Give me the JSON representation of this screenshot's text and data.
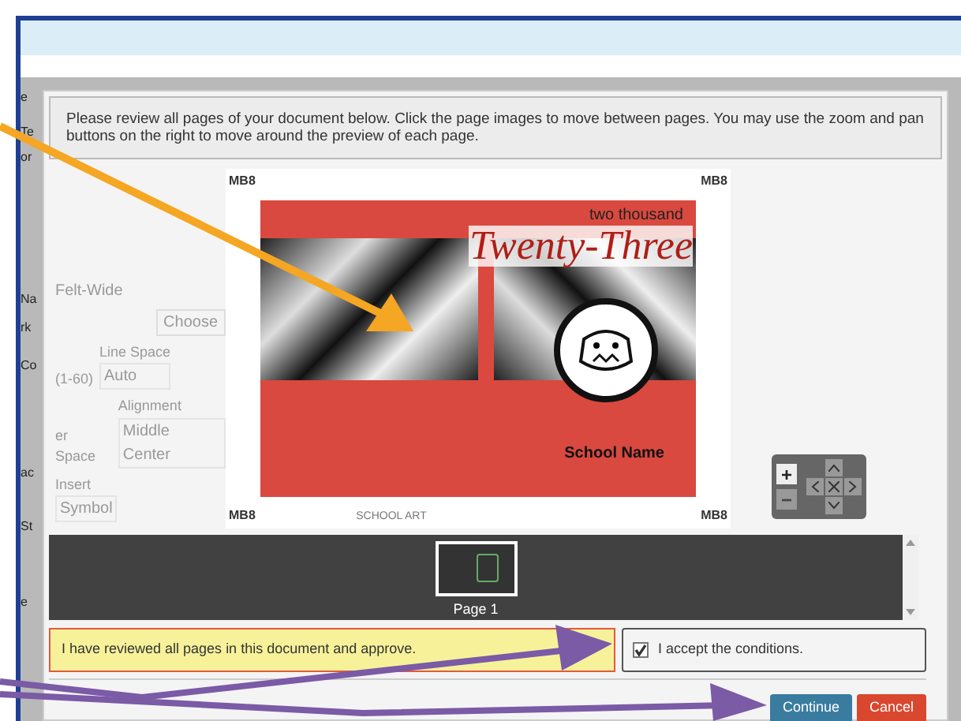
{
  "app_sidebar_fragments": [
    "e",
    "Te",
    "or",
    "Na",
    "rk",
    "Co",
    "ac",
    "St",
    "e"
  ],
  "background_form": [
    {
      "kind": "select",
      "value": "Felt-Wide"
    },
    {
      "kind": "button",
      "value": "Choose"
    },
    {
      "kind": "pair",
      "label": "Line Space",
      "value": "Auto",
      "side": "(1-60)"
    },
    {
      "kind": "pair",
      "label": "Alignment",
      "value": "Middle Center",
      "side": "er Space"
    },
    {
      "kind": "pair",
      "label": "Insert",
      "value": "Symbol"
    }
  ],
  "instructions": "Please review all pages of your document below. Click the page images to move between pages. You may use the zoom and pan buttons on the right to move around the preview of each page.",
  "preview": {
    "crop_marks": [
      "MB8",
      "MB8",
      "MB8",
      "MB8"
    ],
    "year_line": "two thousand",
    "title": "Twenty-Three",
    "school_name": "School Name",
    "back_label": "SCHOOL ART"
  },
  "zoom_buttons": [
    "+",
    "−"
  ],
  "thumbnails": [
    {
      "label": "Page 1",
      "selected": true
    }
  ],
  "approval": {
    "statement": "I have reviewed all pages in this document and approve.",
    "checkbox_label": "I accept the conditions.",
    "checked": true
  },
  "buttons": [
    {
      "label": "Continue",
      "kind": "primary"
    },
    {
      "label": "Cancel",
      "kind": "danger"
    }
  ]
}
